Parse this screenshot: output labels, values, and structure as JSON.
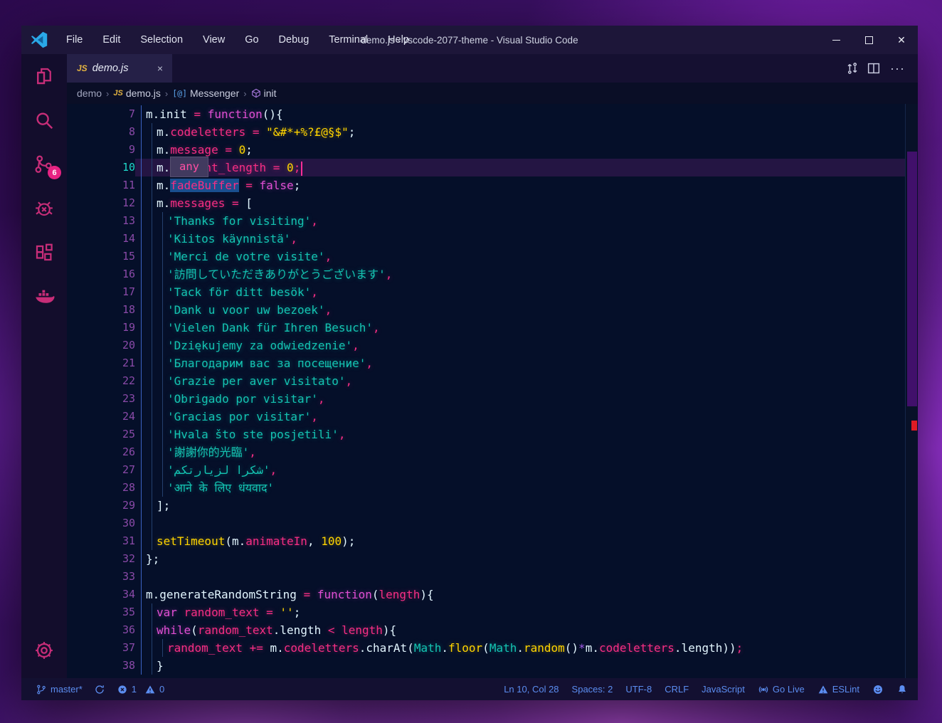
{
  "window_title": "demo.js - vscode-2077-theme - Visual Studio Code",
  "menu": {
    "items": [
      "File",
      "Edit",
      "Selection",
      "View",
      "Go",
      "Debug",
      "Terminal",
      "Help"
    ]
  },
  "tab": {
    "badge": "JS",
    "label": "demo.js",
    "close": "×"
  },
  "editor_actions": {
    "more": "···"
  },
  "breadcrumb": {
    "root": "demo",
    "file_badge": "JS",
    "file": "demo.js",
    "symbol_parent_icon": "[@]",
    "symbol_parent": "Messenger",
    "symbol": "init",
    "separator": "›"
  },
  "activity_bar": {
    "icons": [
      "explorer",
      "search",
      "source-control",
      "debug",
      "extensions",
      "docker",
      "settings"
    ],
    "source_control_badge": "6"
  },
  "editor": {
    "hover_tooltip": "any",
    "lines": [
      {
        "n": "7",
        "i": 1,
        "t": [
          [
            "w",
            "m.init "
          ],
          [
            "p",
            "= "
          ],
          [
            "k",
            "function"
          ],
          [
            "w",
            "(){"
          ]
        ]
      },
      {
        "n": "8",
        "i": 2,
        "t": [
          [
            "w",
            "m."
          ],
          [
            "p",
            "codeletters"
          ],
          [
            "w",
            " "
          ],
          [
            "p",
            "="
          ],
          [
            "w",
            " "
          ],
          [
            "y",
            "\"&#*+%?£@§$\""
          ],
          [
            "w",
            ";"
          ]
        ]
      },
      {
        "n": "9",
        "i": 2,
        "t": [
          [
            "w",
            "m."
          ],
          [
            "p",
            "message"
          ],
          [
            "w",
            " "
          ],
          [
            "p",
            "="
          ],
          [
            "w",
            " "
          ],
          [
            "y",
            "0"
          ],
          [
            "w",
            ";"
          ]
        ]
      },
      {
        "n": "10",
        "i": 2,
        "cur": true,
        "t": [
          [
            "w",
            "m."
          ],
          [
            "p",
            "current_length"
          ],
          [
            "w",
            " "
          ],
          [
            "p",
            "="
          ],
          [
            "w",
            " "
          ],
          [
            "y",
            "0"
          ],
          [
            "p",
            ";"
          ]
        ]
      },
      {
        "n": "11",
        "i": 2,
        "t": [
          [
            "w",
            "m."
          ],
          [
            "s",
            "fadeBuffer"
          ],
          [
            "w",
            " "
          ],
          [
            "p",
            "="
          ],
          [
            "w",
            " "
          ],
          [
            "k",
            "false"
          ],
          [
            "w",
            ";"
          ]
        ]
      },
      {
        "n": "12",
        "i": 2,
        "t": [
          [
            "w",
            "m."
          ],
          [
            "p",
            "messages"
          ],
          [
            "w",
            " "
          ],
          [
            "p",
            "="
          ],
          [
            "w",
            " "
          ],
          [
            "w",
            "["
          ]
        ]
      },
      {
        "n": "13",
        "i": 3,
        "t": [
          [
            "t",
            "'Thanks for visiting'"
          ],
          [
            "p",
            ","
          ]
        ]
      },
      {
        "n": "14",
        "i": 3,
        "t": [
          [
            "t",
            "'Kiitos käynnistä'"
          ],
          [
            "p",
            ","
          ]
        ]
      },
      {
        "n": "15",
        "i": 3,
        "t": [
          [
            "t",
            "'Merci de votre visite'"
          ],
          [
            "p",
            ","
          ]
        ]
      },
      {
        "n": "16",
        "i": 3,
        "t": [
          [
            "t",
            "'訪問していただきありがとうございます'"
          ],
          [
            "p",
            ","
          ]
        ]
      },
      {
        "n": "17",
        "i": 3,
        "t": [
          [
            "t",
            "'Tack för ditt besök'"
          ],
          [
            "p",
            ","
          ]
        ]
      },
      {
        "n": "18",
        "i": 3,
        "t": [
          [
            "t",
            "'Dank u voor uw bezoek'"
          ],
          [
            "p",
            ","
          ]
        ]
      },
      {
        "n": "19",
        "i": 3,
        "t": [
          [
            "t",
            "'Vielen Dank für Ihren Besuch'"
          ],
          [
            "p",
            ","
          ]
        ]
      },
      {
        "n": "20",
        "i": 3,
        "t": [
          [
            "t",
            "'Dziękujemy za odwiedzenie'"
          ],
          [
            "p",
            ","
          ]
        ]
      },
      {
        "n": "21",
        "i": 3,
        "t": [
          [
            "t",
            "'Благодарим вас за посещение'"
          ],
          [
            "p",
            ","
          ]
        ]
      },
      {
        "n": "22",
        "i": 3,
        "t": [
          [
            "t",
            "'Grazie per aver visitato'"
          ],
          [
            "p",
            ","
          ]
        ]
      },
      {
        "n": "23",
        "i": 3,
        "t": [
          [
            "t",
            "'Obrigado por visitar'"
          ],
          [
            "p",
            ","
          ]
        ]
      },
      {
        "n": "24",
        "i": 3,
        "t": [
          [
            "t",
            "'Gracias por visitar'"
          ],
          [
            "p",
            ","
          ]
        ]
      },
      {
        "n": "25",
        "i": 3,
        "t": [
          [
            "t",
            "'Hvala što ste posjetili'"
          ],
          [
            "p",
            ","
          ]
        ]
      },
      {
        "n": "26",
        "i": 3,
        "t": [
          [
            "t",
            "'謝謝你的光臨'"
          ],
          [
            "p",
            ","
          ]
        ]
      },
      {
        "n": "27",
        "i": 3,
        "t": [
          [
            "t",
            "'شكرا لزيارتكم'"
          ],
          [
            "p",
            ","
          ]
        ]
      },
      {
        "n": "28",
        "i": 3,
        "t": [
          [
            "t",
            "'आने के लिए धंयवाद'"
          ]
        ]
      },
      {
        "n": "29",
        "i": 2,
        "t": [
          [
            "w",
            "];"
          ]
        ]
      },
      {
        "n": "30",
        "i": 2,
        "t": []
      },
      {
        "n": "31",
        "i": 2,
        "t": [
          [
            "y",
            "setTimeout"
          ],
          [
            "w",
            "("
          ],
          [
            "w",
            "m."
          ],
          [
            "p",
            "animateIn"
          ],
          [
            "w",
            ", "
          ],
          [
            "y",
            "100"
          ],
          [
            "w",
            ");"
          ]
        ]
      },
      {
        "n": "32",
        "i": 1,
        "t": [
          [
            "w",
            "};"
          ]
        ]
      },
      {
        "n": "33",
        "i": 1,
        "t": []
      },
      {
        "n": "34",
        "i": 1,
        "t": [
          [
            "w",
            "m.generateRandomString "
          ],
          [
            "p",
            "= "
          ],
          [
            "k",
            "function"
          ],
          [
            "w",
            "("
          ],
          [
            "p",
            "length"
          ],
          [
            "w",
            "){"
          ]
        ]
      },
      {
        "n": "35",
        "i": 2,
        "t": [
          [
            "k",
            "var "
          ],
          [
            "p",
            "random_text"
          ],
          [
            "w",
            " "
          ],
          [
            "p",
            "="
          ],
          [
            "w",
            " "
          ],
          [
            "y",
            "''"
          ],
          [
            "w",
            ";"
          ]
        ]
      },
      {
        "n": "36",
        "i": 2,
        "t": [
          [
            "k",
            "while"
          ],
          [
            "w",
            "("
          ],
          [
            "p",
            "random_text"
          ],
          [
            "w",
            ".length "
          ],
          [
            "p",
            "< "
          ],
          [
            "p",
            "length"
          ],
          [
            "w",
            "){"
          ]
        ]
      },
      {
        "n": "37",
        "i": 3,
        "t": [
          [
            "p",
            "random_text"
          ],
          [
            "w",
            " "
          ],
          [
            "p",
            "+= "
          ],
          [
            "w",
            "m."
          ],
          [
            "p",
            "codeletters"
          ],
          [
            "w",
            "."
          ],
          [
            "w",
            "charAt"
          ],
          [
            "w",
            "("
          ],
          [
            "t",
            "Math"
          ],
          [
            "w",
            "."
          ],
          [
            "y",
            "floor"
          ],
          [
            "w",
            "("
          ],
          [
            "t",
            "Math"
          ],
          [
            "w",
            "."
          ],
          [
            "y",
            "random"
          ],
          [
            "w",
            "()"
          ],
          [
            "v",
            "*"
          ],
          [
            "w",
            "m."
          ],
          [
            "p",
            "codeletters"
          ],
          [
            "w",
            ".length"
          ],
          [
            "w",
            "))"
          ],
          [
            "p",
            ";"
          ]
        ]
      },
      {
        "n": "38",
        "i": 2,
        "t": [
          [
            "w",
            "}"
          ]
        ]
      }
    ]
  },
  "status_bar": {
    "left": {
      "branch": "master*",
      "errors": "1",
      "warnings": "0"
    },
    "right": {
      "position": "Ln 10, Col 28",
      "indent": "Spaces: 2",
      "encoding": "UTF-8",
      "eol": "CRLF",
      "language": "JavaScript",
      "go_live": "Go Live",
      "eslint": "ESLint"
    }
  },
  "colors": {
    "accent_pink": "#c72d78",
    "badge_pink": "#e82383",
    "status_blue": "#5b8df0",
    "keyword_magenta": "#e04fd4",
    "property_pink": "#f62e84",
    "string_yellow": "#ffd400",
    "string_teal": "#14c4b2",
    "default_text": "#e3f6ff",
    "editor_bg": "#050f29",
    "current_line": "#241543",
    "selection_blue": "#1a4f8f",
    "error_red": "#e01b24"
  }
}
